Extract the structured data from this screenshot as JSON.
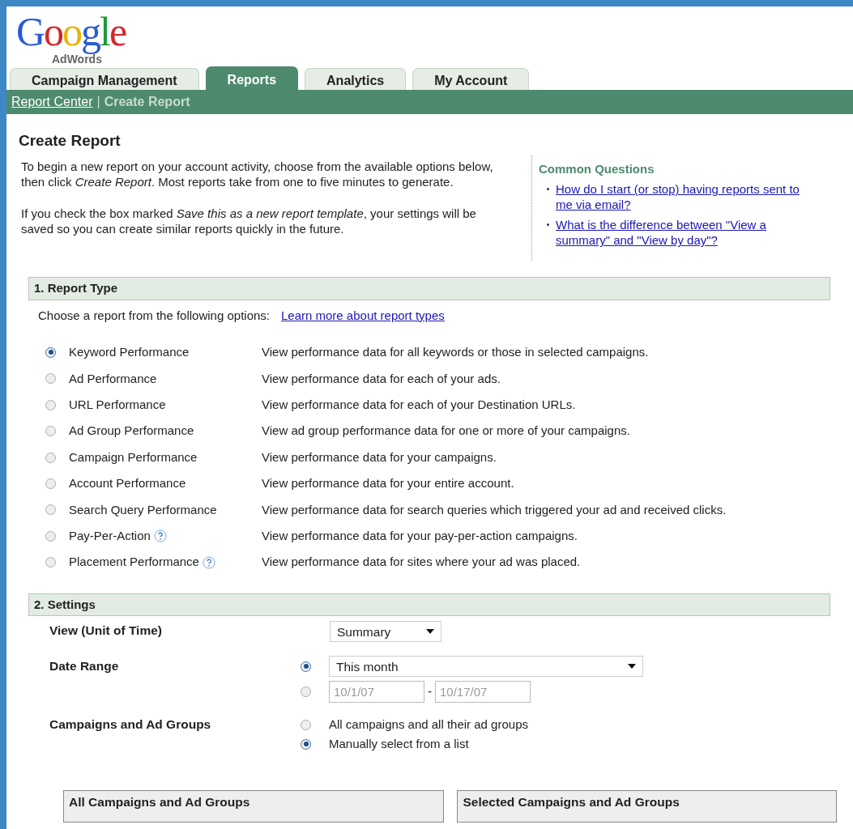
{
  "logo": {
    "word": "Google",
    "product": "AdWords"
  },
  "tabs": [
    {
      "label": "Campaign Management",
      "selected": false
    },
    {
      "label": "Reports",
      "selected": true
    },
    {
      "label": "Analytics",
      "selected": false
    },
    {
      "label": "My Account",
      "selected": false
    }
  ],
  "breadcrumb": [
    {
      "label": "Report Center",
      "kind": "link"
    },
    {
      "label": "|",
      "kind": "separator"
    },
    {
      "label": "Create Report",
      "kind": "current"
    }
  ],
  "page_title": "Create Report",
  "intro": [
    "To begin a new report on your account activity, choose from the available options below, then click *Create Report*. Most reports take from one to five minutes to generate.",
    "If you check the box marked *Save this as a new report template*, your settings will be saved so you can create similar reports quickly in the future."
  ],
  "common_questions": {
    "title": "Common Questions",
    "links": [
      "How do I start (or stop) having reports sent to me via email?",
      "What is the difference between \"View a summary\" and \"View by day\"?"
    ]
  },
  "report_type": {
    "title": "1. Report Type",
    "prompt": "Choose a report from the following options:",
    "learn_more": "Learn more about report types",
    "options": [
      {
        "name": "Keyword Performance",
        "description": "View performance data for all keywords or those in selected campaigns.",
        "selected": true,
        "help": false
      },
      {
        "name": "Ad Performance",
        "description": "View performance data for each of your ads.",
        "selected": false,
        "help": false
      },
      {
        "name": "URL Performance",
        "description": "View performance data for each of your Destination URLs.",
        "selected": false,
        "help": false
      },
      {
        "name": "Ad Group Performance",
        "description": "View ad group performance data for one or more of your campaigns.",
        "selected": false,
        "help": false
      },
      {
        "name": "Campaign Performance",
        "description": "View performance data for your campaigns.",
        "selected": false,
        "help": false
      },
      {
        "name": "Account Performance",
        "description": "View performance data for your entire account.",
        "selected": false,
        "help": false
      },
      {
        "name": "Search Query Performance",
        "description": "View performance data for search queries which triggered your ad and received clicks.",
        "selected": false,
        "help": false
      },
      {
        "name": "Pay-Per-Action",
        "description": "View performance data for your pay-per-action campaigns.",
        "selected": false,
        "help": true
      },
      {
        "name": "Placement Performance",
        "description": "View performance data for sites where your ad was placed.",
        "selected": false,
        "help": true
      }
    ]
  },
  "settings": {
    "title": "2. Settings",
    "view": {
      "label": "View (Unit of Time)",
      "value": "Summary"
    },
    "date_range": {
      "label": "Date Range",
      "preset": {
        "value": "This month",
        "selected": true
      },
      "custom": {
        "selected": false,
        "start": "10/1/07",
        "end": "10/17/07",
        "separator": "-"
      }
    },
    "campaigns": {
      "label": "Campaigns and Ad Groups",
      "options": [
        {
          "label": "All campaigns and all their ad groups",
          "selected": false
        },
        {
          "label": "Manually select from a list",
          "selected": true
        }
      ]
    },
    "panels": [
      "All Campaigns and Ad Groups",
      "Selected Campaigns and Ad Groups"
    ]
  }
}
